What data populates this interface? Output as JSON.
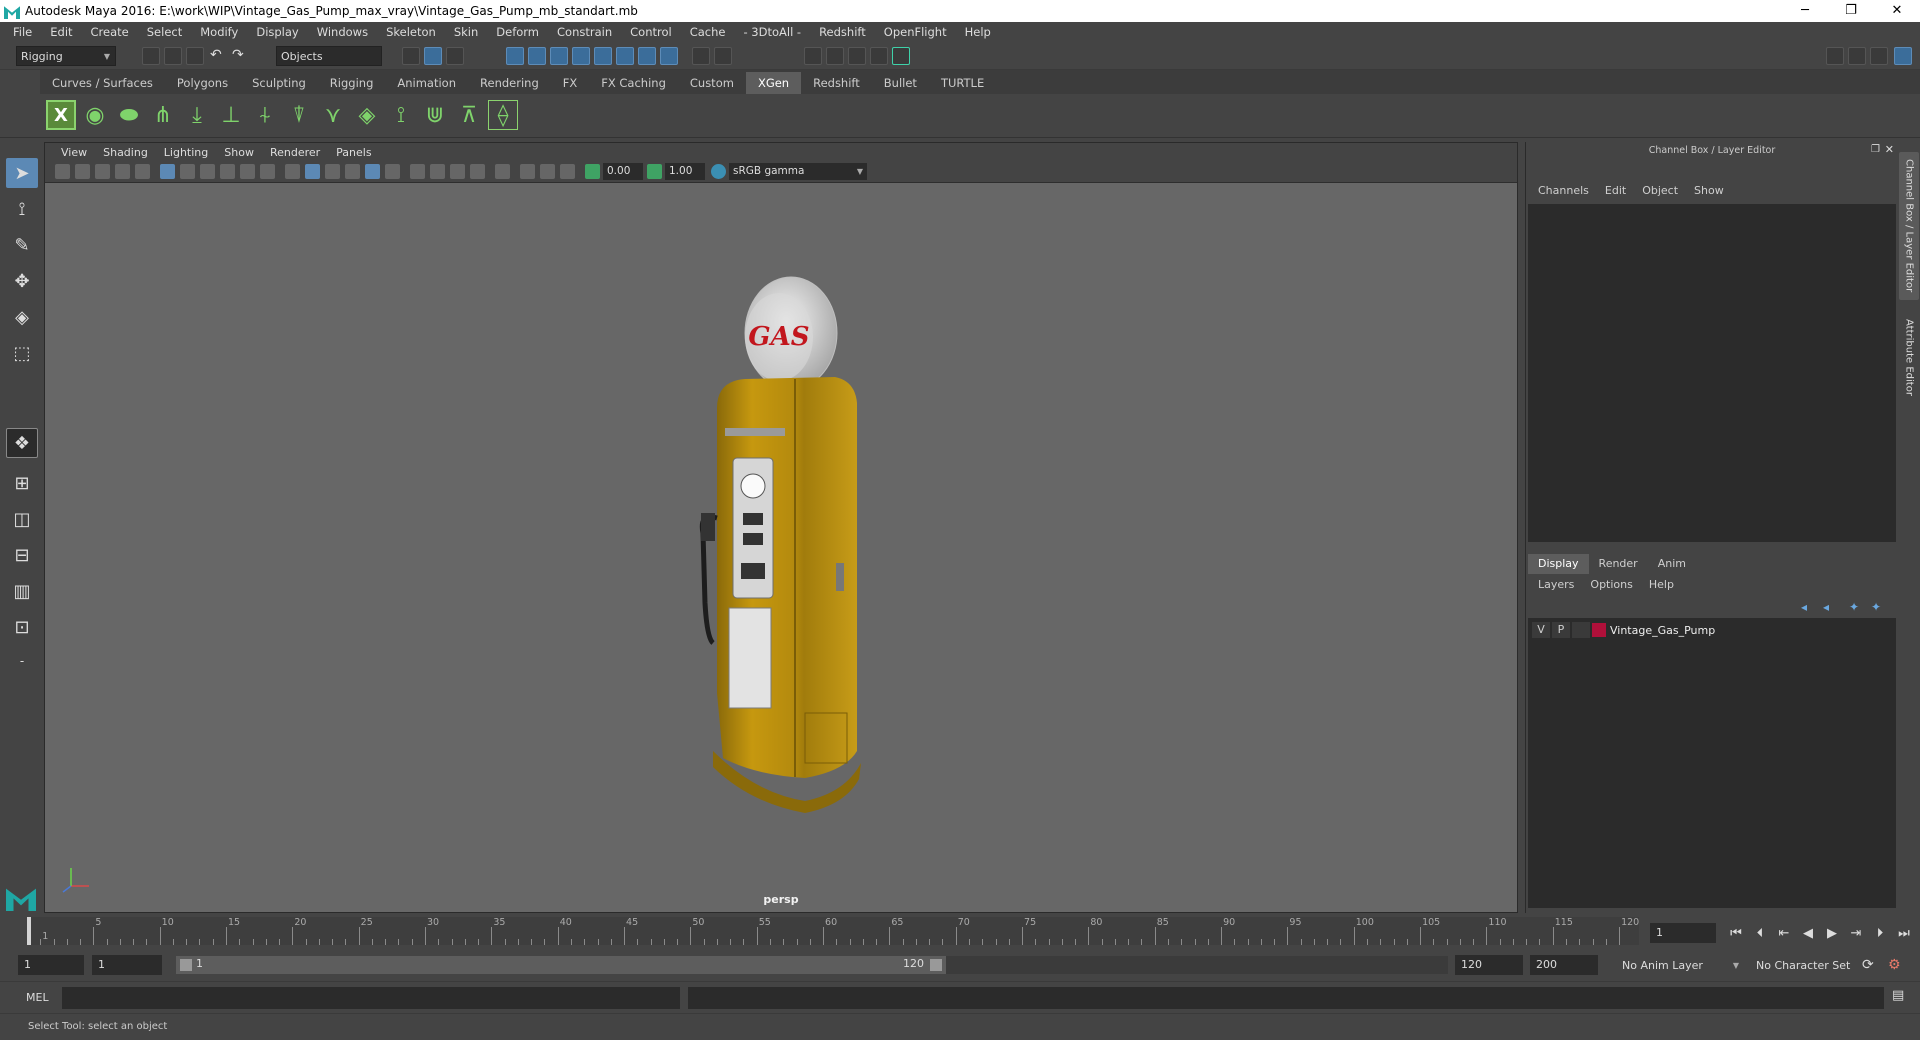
{
  "window": {
    "title": "Autodesk Maya 2016: E:\\work\\WIP\\Vintage_Gas_Pump_max_vray\\Vintage_Gas_Pump_mb_standart.mb",
    "minimize": "─",
    "restore": "❐",
    "close": "✕"
  },
  "menubar": [
    "File",
    "Edit",
    "Create",
    "Select",
    "Modify",
    "Display",
    "Windows",
    "Skeleton",
    "Skin",
    "Deform",
    "Constrain",
    "Control",
    "Cache",
    "- 3DtoAll -",
    "Redshift",
    "OpenFlight",
    "Help"
  ],
  "status": {
    "menuset": "Rigging",
    "selmode": "Objects"
  },
  "shelf": {
    "tabs": [
      "Curves / Surfaces",
      "Polygons",
      "Sculpting",
      "Rigging",
      "Animation",
      "Rendering",
      "FX",
      "FX Caching",
      "Custom",
      "XGen",
      "Redshift",
      "Bullet",
      "TURTLE"
    ],
    "active": "XGen"
  },
  "viewport": {
    "menu": [
      "View",
      "Shading",
      "Lighting",
      "Show",
      "Renderer",
      "Panels"
    ],
    "exposure": "0.00",
    "gamma": "1.00",
    "colorspace": "sRGB gamma",
    "camera": "persp",
    "model_text": "GAS"
  },
  "channelbox": {
    "header": "Channel Box / Layer Editor",
    "menu": [
      "Channels",
      "Edit",
      "Object",
      "Show"
    ]
  },
  "layereditor": {
    "tabs": [
      "Display",
      "Render",
      "Anim"
    ],
    "active": "Display",
    "menu": [
      "Layers",
      "Options",
      "Help"
    ],
    "layers": [
      {
        "v": "V",
        "p": "P",
        "name": "Vintage_Gas_Pump",
        "color": "#b0103a"
      }
    ]
  },
  "side_tabs": [
    "Channel Box / Layer Editor",
    "Attribute Editor"
  ],
  "timeline": {
    "ticks": [
      "1",
      "5",
      "10",
      "15",
      "20",
      "25",
      "30",
      "35",
      "40",
      "45",
      "50",
      "55",
      "60",
      "65",
      "70",
      "75",
      "80",
      "85",
      "90",
      "95",
      "100",
      "105",
      "110",
      "115",
      "120"
    ],
    "current_frame": "1"
  },
  "range": {
    "start": "1",
    "playstart": "1",
    "slider_start": "1",
    "slider_end": "120",
    "playend": "120",
    "end": "200",
    "anim_layer": "No Anim Layer",
    "char_set": "No Character Set"
  },
  "cmd": {
    "label": "MEL"
  },
  "help": {
    "text": "Select Tool: select an object"
  }
}
